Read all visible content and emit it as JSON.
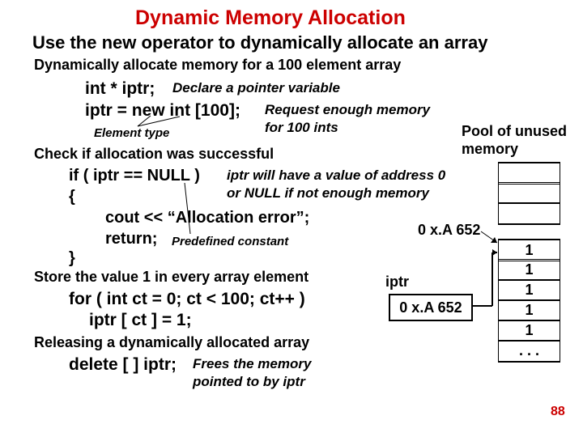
{
  "title": "Dynamic Memory Allocation",
  "line1": "Use the new operator to dynamically allocate an array",
  "line2": "Dynamically allocate memory for a 100 element array",
  "decl_code": "int * iptr;",
  "decl_annot": "Declare a pointer variable",
  "new_code": "iptr = new int [100];",
  "new_annot1": "Request enough memory",
  "new_annot2": "for 100  ints",
  "el_type": "Element type",
  "check_h": "Check if allocation was successful",
  "if_line": "if ( iptr == NULL )",
  "if_annot1": "iptr will have a value of address 0",
  "if_annot2": "or NULL if not enough memory",
  "brace_open": "{",
  "cout_line": "cout << “Allocation error”;",
  "return_line": "return;",
  "return_annot": "Predefined constant",
  "brace_close": "}",
  "store_h": "Store the value 1 in every array element",
  "for_line": "for ( int ct = 0; ct < 100; ct++ )",
  "assign_line": "iptr [ ct ] = 1;",
  "release_h": "Releasing a dynamically allocated array",
  "delete_code": "delete [ ] iptr;",
  "delete_annot1": "Frees the memory",
  "delete_annot2": "pointed to by iptr",
  "pool1": "Pool of unused",
  "pool2": "memory",
  "addr": "0 x.A 652",
  "ptr_addr": "0 x.A 652",
  "iptr_label": "iptr",
  "cells": [
    "1",
    "1",
    "1",
    "1",
    "1",
    ".  .  ."
  ],
  "page": "88"
}
